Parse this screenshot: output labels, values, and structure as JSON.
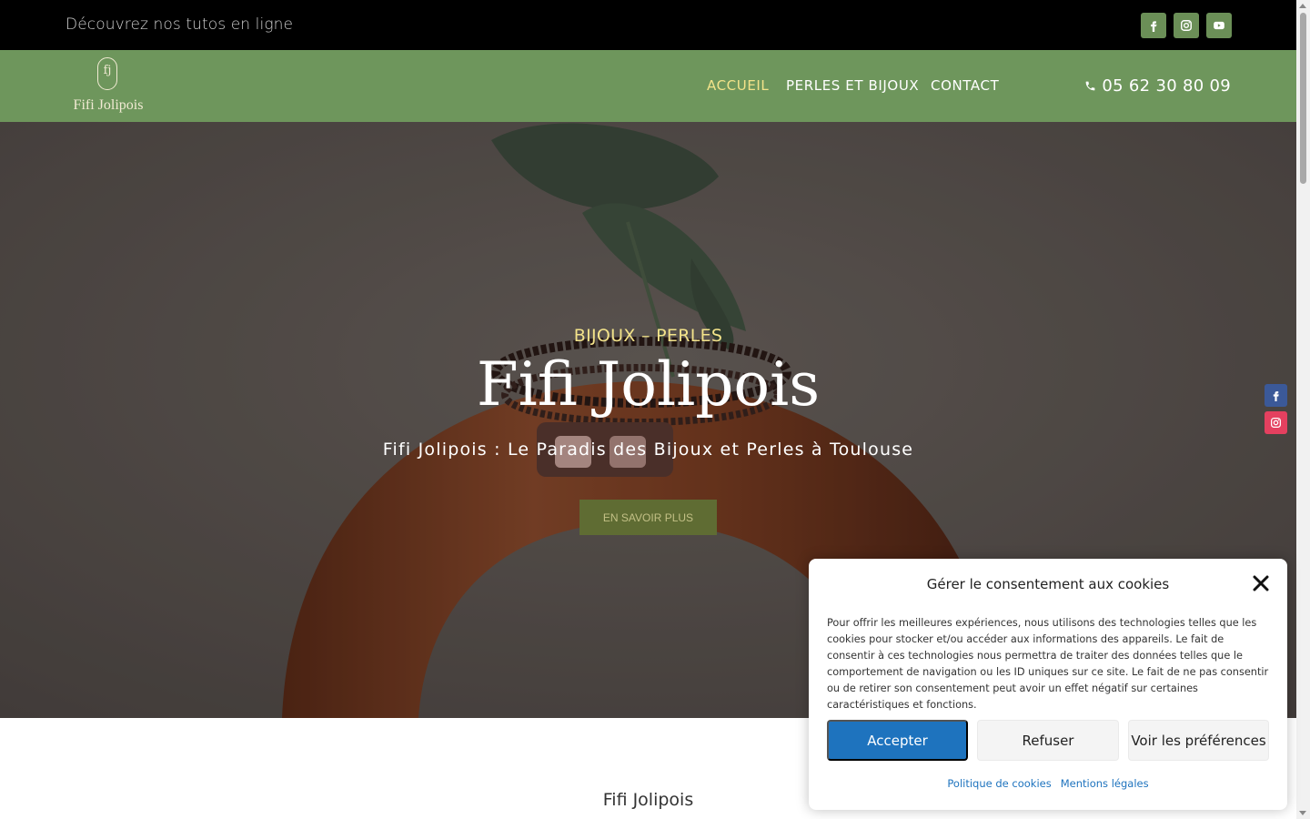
{
  "topbar": {
    "text": "Découvrez nos tutos en ligne",
    "socials": [
      {
        "icon": "facebook-icon"
      },
      {
        "icon": "instagram-icon"
      },
      {
        "icon": "youtube-icon"
      }
    ]
  },
  "header": {
    "logo_monogram": "fj",
    "logo_text": "Fifi Jolipois",
    "nav": [
      {
        "label": "ACCUEIL",
        "active": true
      },
      {
        "label": "PERLES ET BIJOUX",
        "active": false
      },
      {
        "label": "CONTACT",
        "active": false
      }
    ],
    "phone_icon": "phone-icon",
    "phone": "05 62 30 80 09"
  },
  "hero": {
    "subtitle": "BIJOUX – PERLES",
    "title": "Fifi Jolipois",
    "description": "Fifi Jolipois : Le Paradis des Bijoux et Perles à Toulouse",
    "button": "EN SAVOIR PLUS"
  },
  "floating_socials": [
    {
      "icon": "facebook-icon",
      "color": "#3b5998"
    },
    {
      "icon": "instagram-icon",
      "color": "#e4405f"
    }
  ],
  "below": {
    "title": "Fifi Jolipois"
  },
  "cookie": {
    "title": "Gérer le consentement aux cookies",
    "text": "Pour offrir les meilleures expériences, nous utilisons des technologies telles que les cookies pour stocker et/ou accéder aux informations des appareils. Le fait de consentir à ces technologies nous permettra de traiter des données telles que le comportement de navigation ou les ID uniques sur ce site. Le fait de ne pas consentir ou de retirer son consentement peut avoir un effet négatif sur certaines caractéristiques et fonctions.",
    "accept": "Accepter",
    "refuse": "Refuser",
    "preferences": "Voir les préférences",
    "links": [
      "Politique de cookies",
      "Mentions légales"
    ]
  },
  "colors": {
    "header_green": "#6e965c",
    "social_green": "#6b8f57",
    "accent_yellow": "#f3e38a",
    "accept_blue": "#1e73be"
  }
}
